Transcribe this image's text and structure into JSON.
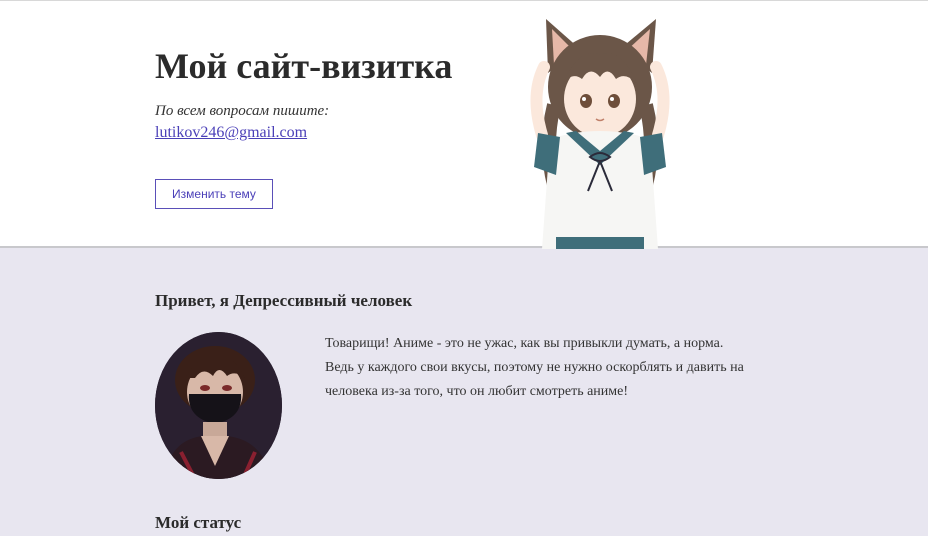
{
  "header": {
    "title": "Мой сайт-визитка",
    "contact_label": "По всем вопросам пишите:",
    "email": "lutikov246@gmail.com",
    "theme_button": "Изменить тему"
  },
  "profile": {
    "greeting": "Привет, я Депрессивный человек",
    "about": "Товарищи! Аниме - это не ужас, как вы привыкли думать, а норма. Ведь у каждого свои вкусы, поэтому не нужно оскорблять и давить на человека из-за того, что он любит смотреть аниме!",
    "status_heading": "Мой статус"
  },
  "colors": {
    "header_bg": "#ffffff",
    "main_bg": "#e8e6f0",
    "accent": "#4a3fb8"
  }
}
